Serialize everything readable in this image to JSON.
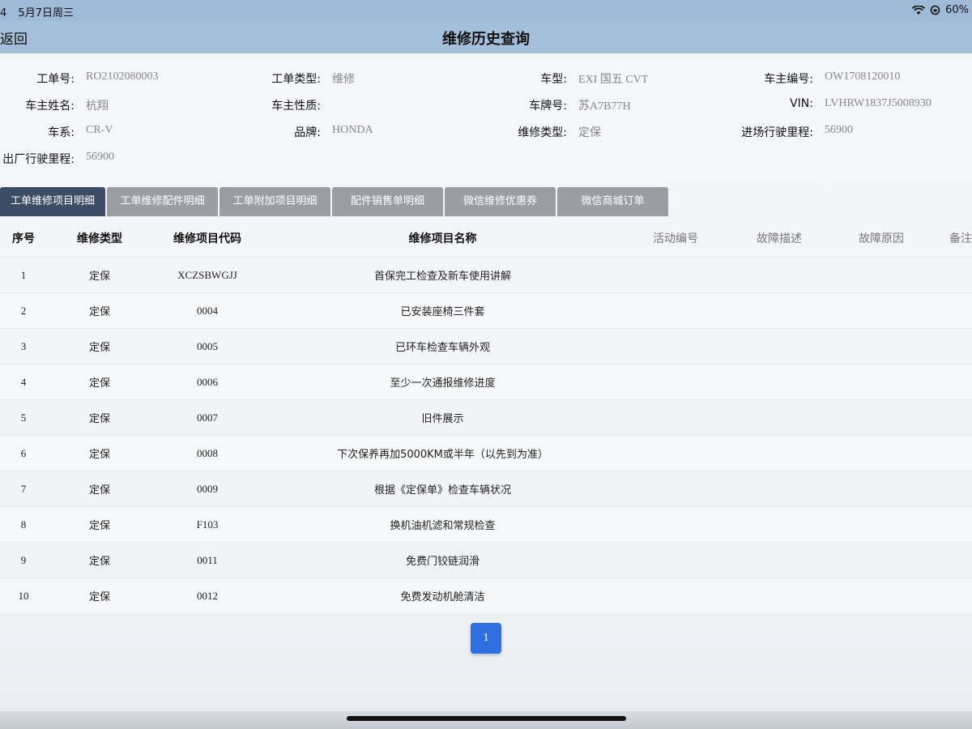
{
  "status_bar": {
    "time": "4",
    "date": "5月7日周三",
    "battery": "60%"
  },
  "nav": {
    "back_label": "返回",
    "title": "维修历史查询"
  },
  "info": [
    {
      "label": "工单号:",
      "value": "RO2102080003"
    },
    {
      "label": "工单类型:",
      "value": "维修"
    },
    {
      "label": "车型:",
      "value": "EXI 国五 CVT"
    },
    {
      "label": "车主编号:",
      "value": "OW1708120010"
    },
    {
      "label": "车主姓名:",
      "value": "杭翔"
    },
    {
      "label": "车主性质:",
      "value": ""
    },
    {
      "label": "车牌号:",
      "value": "苏A7B77H"
    },
    {
      "label": "VIN:",
      "value": "LVHRW1837J5008930"
    },
    {
      "label": "车系:",
      "value": "CR-V"
    },
    {
      "label": "品牌:",
      "value": "HONDA"
    },
    {
      "label": "维修类型:",
      "value": "定保"
    },
    {
      "label": "进场行驶里程:",
      "value": "56900"
    },
    {
      "label": "出厂行驶里程:",
      "value": "56900"
    }
  ],
  "tabs": [
    "工单维修项目明细",
    "工单维修配件明细",
    "工单附加项目明细",
    "配件销售单明细",
    "微信维修优惠券",
    "微信商城订单"
  ],
  "table": {
    "headers": [
      "序号",
      "维修类型",
      "维修项目代码",
      "维修项目名称",
      "活动编号",
      "故障描述",
      "故障原因",
      "备注"
    ],
    "rows": [
      [
        "1",
        "定保",
        "XCZSBWGJJ",
        "首保完工检查及新车使用讲解"
      ],
      [
        "2",
        "定保",
        "0004",
        "已安装座椅三件套"
      ],
      [
        "3",
        "定保",
        "0005",
        "已环车检查车辆外观"
      ],
      [
        "4",
        "定保",
        "0006",
        "至少一次通报维修进度"
      ],
      [
        "5",
        "定保",
        "0007",
        "旧件展示"
      ],
      [
        "6",
        "定保",
        "0008",
        "下次保养再加5000KM或半年（以先到为准）"
      ],
      [
        "7",
        "定保",
        "0009",
        "根据《定保单》检查车辆状况"
      ],
      [
        "8",
        "定保",
        "F103",
        "换机油机滤和常规检查"
      ],
      [
        "9",
        "定保",
        "0011",
        "免费门铰链润滑"
      ],
      [
        "10",
        "定保",
        "0012",
        "免费发动机舱清洁"
      ]
    ]
  },
  "pagination": {
    "current": "1"
  },
  "colors": {
    "nav_bg": "#a4bfd9",
    "active_tab": "#3d4d66",
    "inactive_tab": "#9b9fa5",
    "page_button": "#2f6fe0"
  }
}
